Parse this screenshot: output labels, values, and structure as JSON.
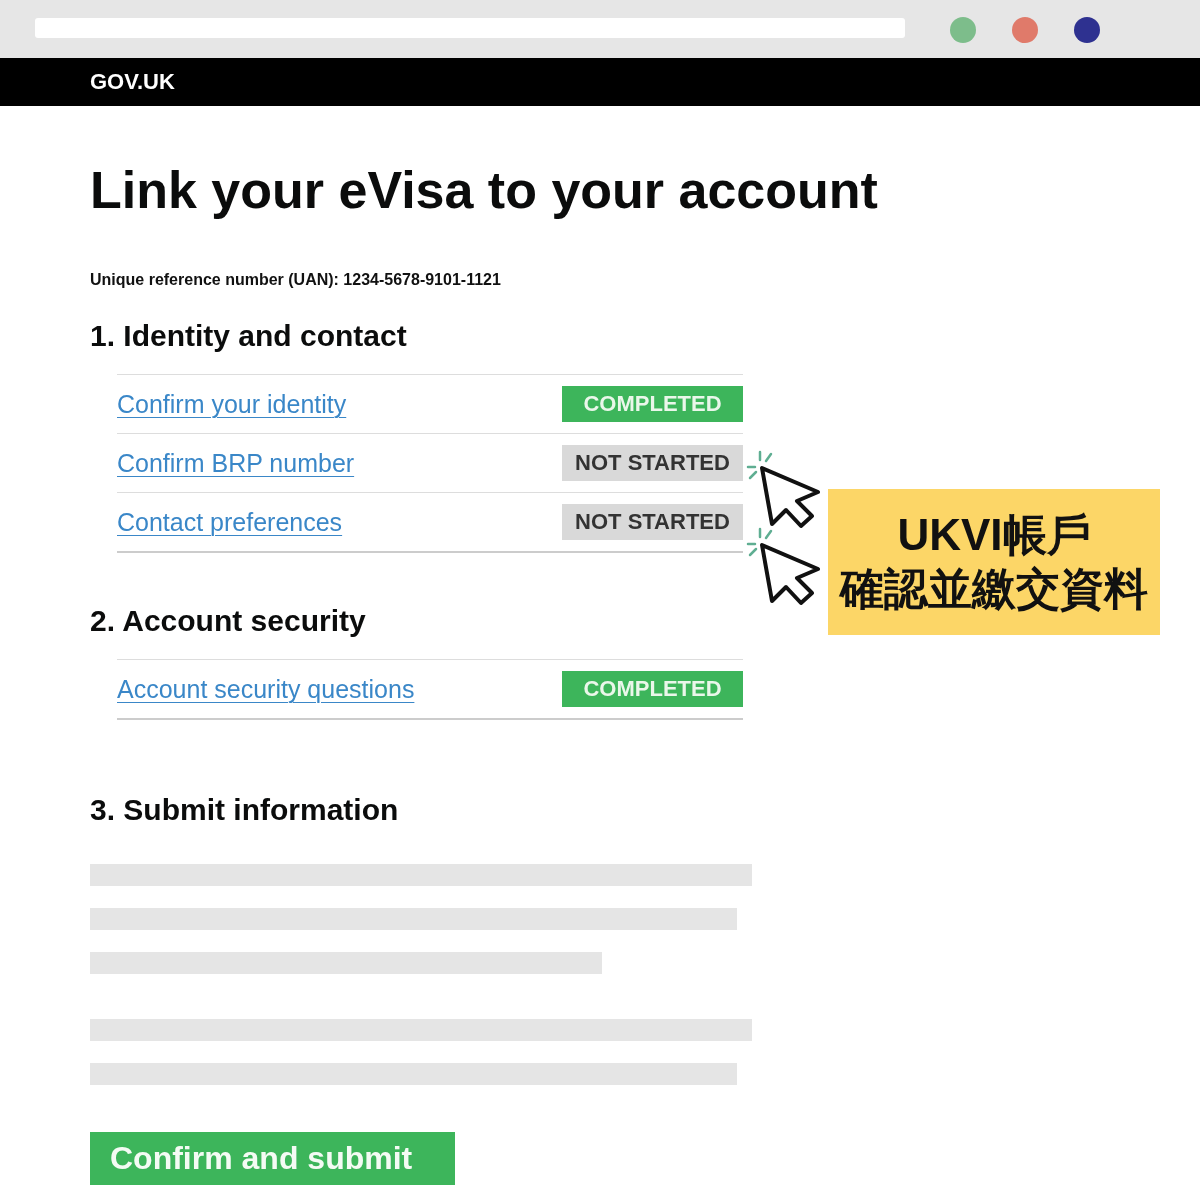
{
  "browser": {
    "dots": [
      {
        "color": "#7dbd8b"
      },
      {
        "color": "#e07a6a"
      },
      {
        "color": "#2e3190"
      }
    ]
  },
  "header": {
    "logo": "GOV.UK"
  },
  "page": {
    "title": "Link your eVisa to your account",
    "reference": "Unique reference number (UAN): 1234-5678-9101-1121"
  },
  "sections": [
    {
      "kind": "tasks",
      "heading": "1. Identity and contact",
      "tasks": [
        {
          "label": "Confirm your identity",
          "status": "COMPLETED",
          "kind": "completed",
          "pointer": false
        },
        {
          "label": "Confirm BRP number",
          "status": "NOT STARTED",
          "kind": "not_started",
          "pointer": true
        },
        {
          "label": "Contact preferences",
          "status": "NOT STARTED",
          "kind": "not_started",
          "pointer": true
        }
      ]
    },
    {
      "kind": "tasks",
      "heading": "2. Account security",
      "tasks": [
        {
          "label": "Account security questions",
          "status": "COMPLETED",
          "kind": "completed",
          "pointer": false
        }
      ]
    },
    {
      "kind": "submit",
      "heading": "3. Submit information",
      "button": "Confirm and submit"
    }
  ],
  "callout": {
    "lines": [
      "UKVI帳戶",
      "確認並繳交資料"
    ]
  }
}
